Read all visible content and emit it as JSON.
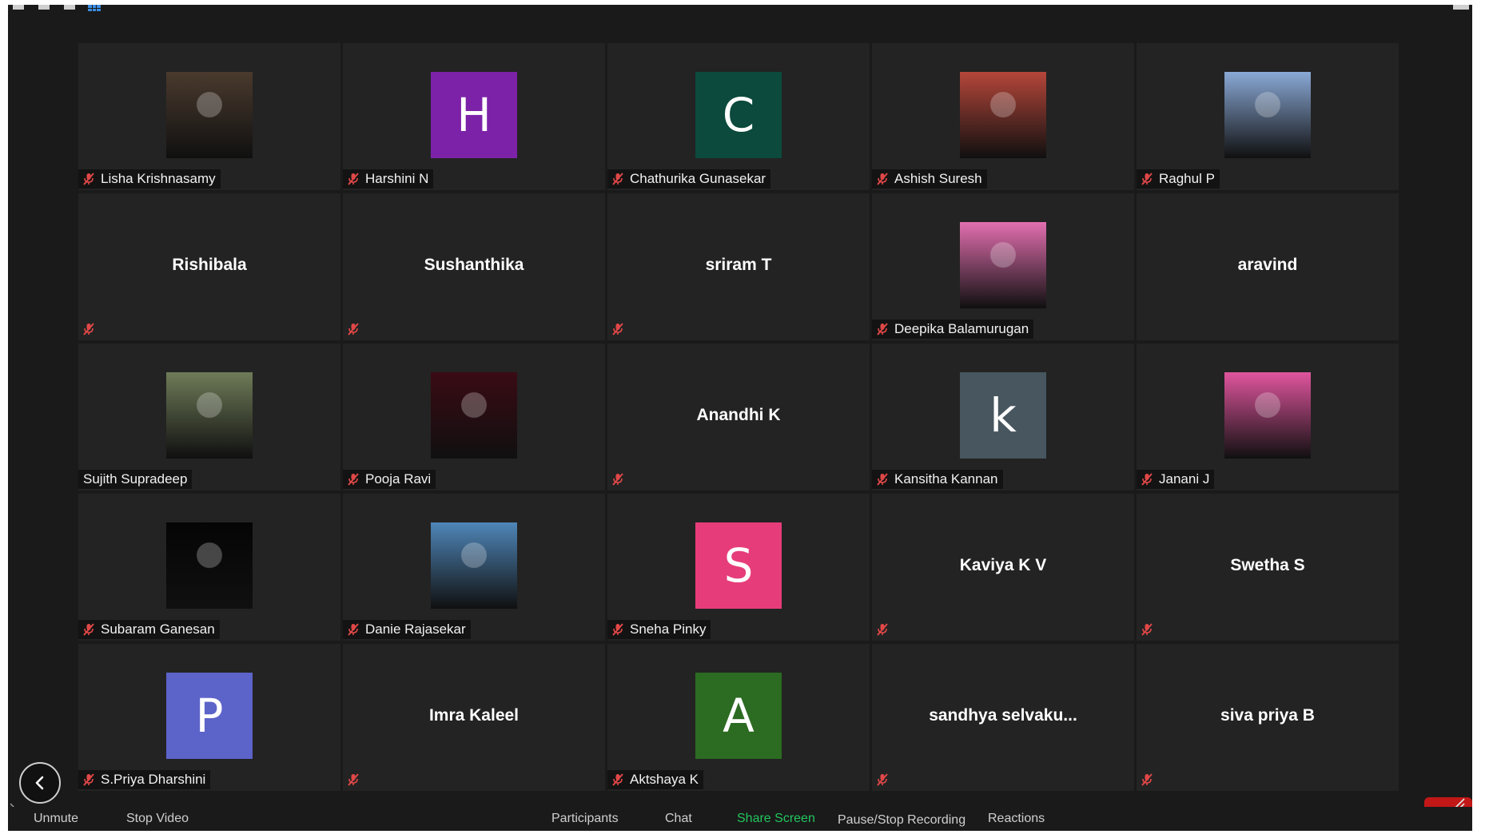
{
  "colors": {
    "window_bg": "#1a1a1a",
    "tile_bg": "#232323",
    "muted_mic": "#e04747",
    "share_screen": "#22c55e"
  },
  "participants": [
    {
      "name": "Lisha Krishnasamy",
      "display": "photo",
      "avatar_color": "#4a3a2e",
      "muted": true
    },
    {
      "name": "Harshini N",
      "display": "initial",
      "initial": "H",
      "avatar_color": "#7c22a8",
      "muted": true
    },
    {
      "name": "Chathurika Gunasekar",
      "display": "initial",
      "initial": "C",
      "avatar_color": "#0b4a3c",
      "muted": true
    },
    {
      "name": "Ashish Suresh",
      "display": "photo",
      "avatar_color": "#b5463a",
      "muted": true
    },
    {
      "name": "Raghul P",
      "display": "photo",
      "avatar_color": "#8aa9d6",
      "muted": true
    },
    {
      "name": "Rishibala",
      "display": "name",
      "muted": true
    },
    {
      "name": "Sushanthika",
      "display": "name",
      "muted": true
    },
    {
      "name": "sriram T",
      "display": "name",
      "muted": true
    },
    {
      "name": "Deepika Balamurugan",
      "display": "photo",
      "avatar_color": "#e36fb0",
      "muted": true
    },
    {
      "name": "aravind",
      "display": "name",
      "muted": false
    },
    {
      "name": "Sujith Supradeep",
      "display": "photo",
      "avatar_color": "#6f7c58",
      "muted": false
    },
    {
      "name": "Pooja Ravi",
      "display": "photo",
      "avatar_color": "#3a0b14",
      "muted": true
    },
    {
      "name": "Anandhi K",
      "display": "name",
      "muted": true
    },
    {
      "name": "Kansitha Kannan",
      "display": "initial",
      "initial": "k",
      "avatar_color": "#47565f",
      "muted": true
    },
    {
      "name": "Janani J",
      "display": "photo",
      "avatar_color": "#e0559e",
      "muted": true
    },
    {
      "name": "Subaram Ganesan",
      "display": "photo",
      "avatar_color": "#050505",
      "muted": true
    },
    {
      "name": "Danie Rajasekar",
      "display": "photo",
      "avatar_color": "#4f86b8",
      "muted": true
    },
    {
      "name": "Sneha Pinky",
      "display": "initial",
      "initial": "S",
      "avatar_color": "#e63d7a",
      "muted": true
    },
    {
      "name": "Kaviya K V",
      "display": "name",
      "muted": true
    },
    {
      "name": "Swetha S",
      "display": "name",
      "muted": true
    },
    {
      "name": "S.Priya Dharshini",
      "display": "initial",
      "initial": "P",
      "avatar_color": "#5c63c9",
      "muted": true
    },
    {
      "name": "Imra Kaleel",
      "display": "name",
      "muted": true
    },
    {
      "name": "Aktshaya K",
      "display": "initial",
      "initial": "A",
      "avatar_color": "#2c6b22",
      "muted": true
    },
    {
      "name": "sandhya  selvaku...",
      "display": "name",
      "muted": true
    },
    {
      "name": "siva priya B",
      "display": "name",
      "muted": true
    }
  ],
  "toolbar": {
    "unmute": "Unmute",
    "stop_video": "Stop Video",
    "participants": "Participants",
    "chat": "Chat",
    "share_screen": "Share Screen",
    "recording": "Pause/Stop Recording",
    "reactions": "Reactions"
  },
  "icons": {
    "muted_mic": "mic-muted-icon",
    "back": "chevron-left-icon",
    "resize": "resize-corner-icon"
  }
}
